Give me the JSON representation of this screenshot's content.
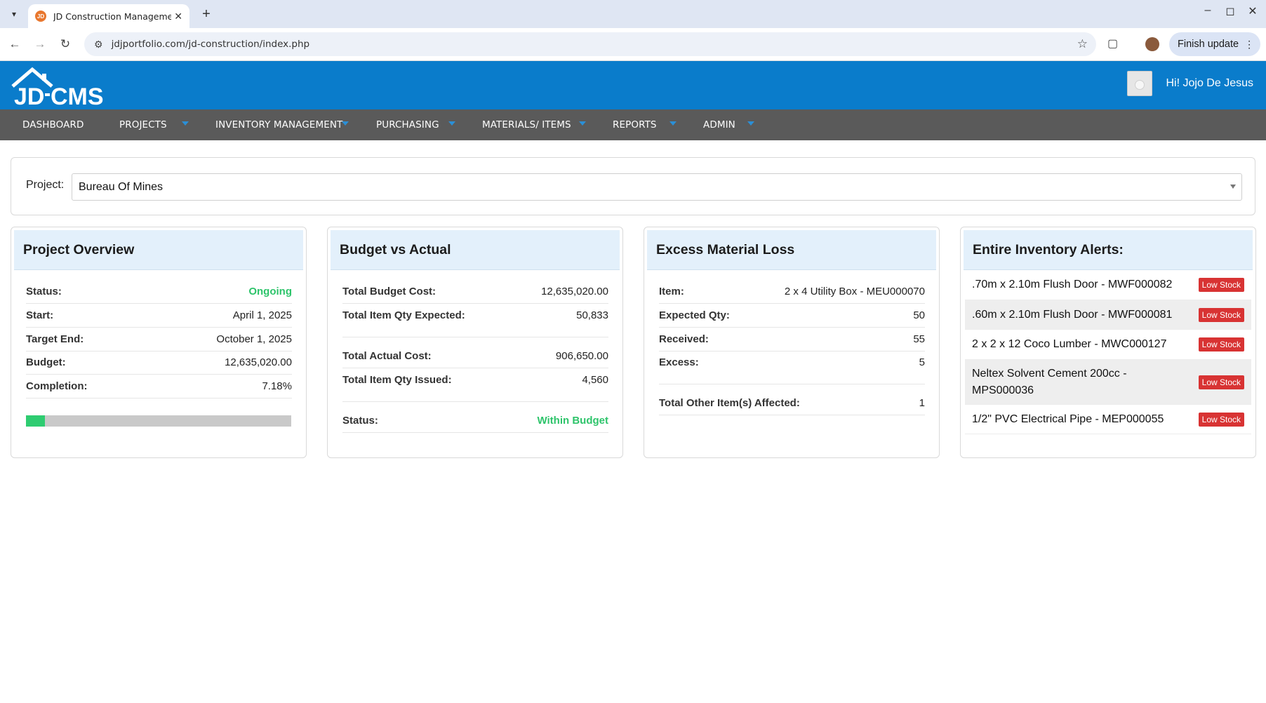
{
  "browser": {
    "tab_title": "JD Construction Management",
    "tab_favicon_text": "JD",
    "url": "jdjportfolio.com/jd-construction/index.php",
    "finish_update_label": "Finish update"
  },
  "header": {
    "logo_text_jd": "JD",
    "logo_text_cms": "CMS",
    "greeting": "Hi! Jojo De Jesus"
  },
  "nav": {
    "items": [
      {
        "label": "DASHBOARD"
      },
      {
        "label": "PROJECTS"
      },
      {
        "label": "INVENTORY MANAGEMENT"
      },
      {
        "label": "PURCHASING"
      },
      {
        "label": "MATERIALS/ ITEMS"
      },
      {
        "label": "REPORTS"
      },
      {
        "label": "ADMIN"
      }
    ]
  },
  "project_filter": {
    "label": "Project:",
    "selected": "Bureau Of Mines"
  },
  "overview": {
    "title": "Project Overview",
    "rows": [
      {
        "label": "Status:",
        "value": "Ongoing"
      },
      {
        "label": "Start:",
        "value": "April 1, 2025"
      },
      {
        "label": "Target End:",
        "value": "October 1, 2025"
      },
      {
        "label": "Budget:",
        "value": "12,635,020.00"
      },
      {
        "label": "Completion:",
        "value": "7.18%"
      }
    ],
    "completion_fraction": 0.0718,
    "status_color": "#2ec46b"
  },
  "budget": {
    "title": "Budget vs Actual",
    "rows": [
      {
        "label": "Total Budget Cost:",
        "value": "12,635,020.00"
      },
      {
        "label": "Total Item Qty Expected:",
        "value": "50,833"
      },
      {
        "label": "Total Actual Cost:",
        "value": "906,650.00"
      },
      {
        "label": "Total Item Qty Issued:",
        "value": "4,560"
      },
      {
        "label": "Status:",
        "value": "Within Budget"
      }
    ]
  },
  "excess": {
    "title": "Excess Material Loss",
    "rows": [
      {
        "label": "Item:",
        "value": "2 x 4 Utility Box - MEU000070"
      },
      {
        "label": "Expected Qty:",
        "value": "50"
      },
      {
        "label": "Received:",
        "value": "55"
      },
      {
        "label": "Excess:",
        "value": "5"
      },
      {
        "label": "Total Other Item(s) Affected:",
        "value": "1"
      }
    ]
  },
  "alerts": {
    "title": "Entire Inventory Alerts:",
    "items": [
      {
        "name": ".70m x 2.10m Flush Door - MWF000082",
        "badge": "Low Stock"
      },
      {
        "name": ".60m x 2.10m Flush Door - MWF000081",
        "badge": "Low Stock"
      },
      {
        "name": "2 x 2 x 12 Coco Lumber - MWC000127",
        "badge": "Low Stock"
      },
      {
        "name": "Neltex Solvent Cement 200cc - MPS000036",
        "badge": "Low Stock"
      },
      {
        "name": "1/2\" PVC Electrical Pipe - MEP000055",
        "badge": "Low Stock"
      }
    ],
    "badge_color": "#d83333"
  },
  "colors": {
    "header_blue": "#0a7ccb",
    "nav_gray": "#5a5a5a",
    "card_head": "#e3f0fb"
  }
}
